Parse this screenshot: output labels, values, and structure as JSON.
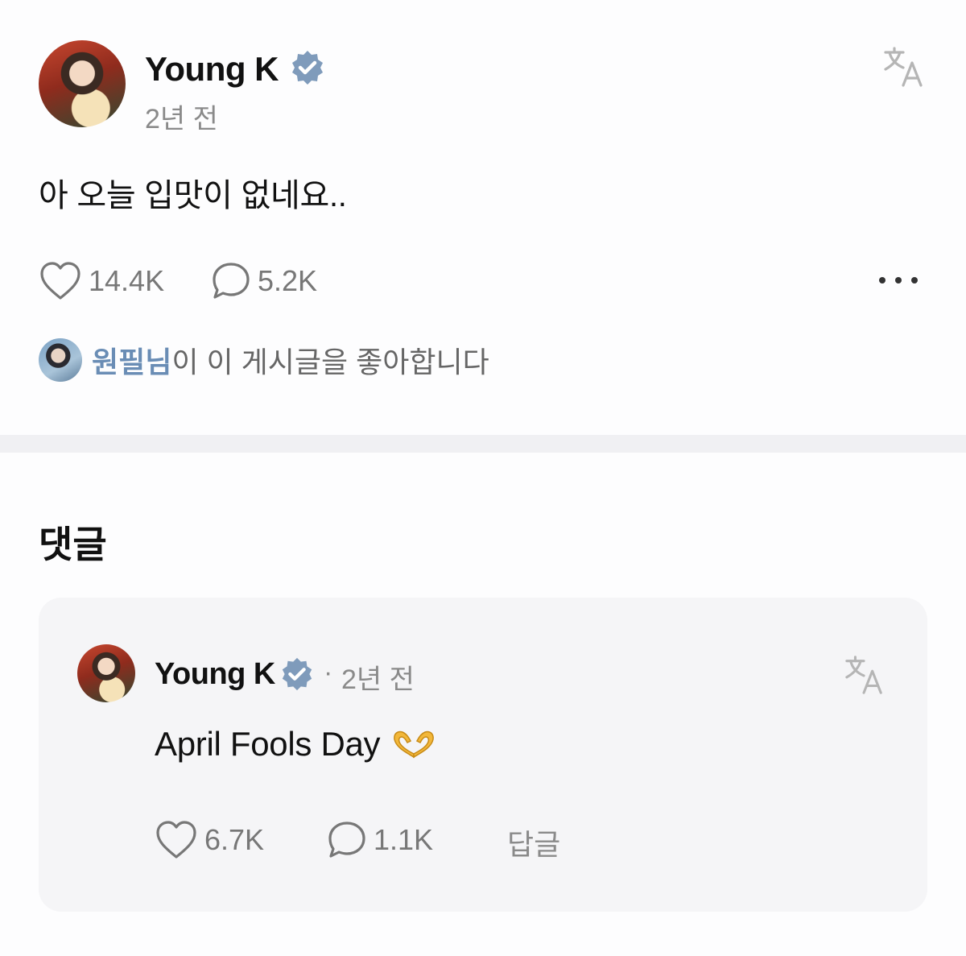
{
  "post": {
    "author": "Young K",
    "time": "2년 전",
    "text": "아 오늘 입맛이 없네요..",
    "likes": "14.4K",
    "comments": "5.2K",
    "liked_by": {
      "name": "원필님",
      "suffix": "이 이 게시글을 좋아합니다"
    }
  },
  "comments_section": {
    "title": "댓글",
    "comment": {
      "author": "Young K",
      "separator": "·",
      "time": "2년 전",
      "text": "April Fools Day",
      "likes": "6.7K",
      "replies": "1.1K",
      "reply_label": "답글"
    }
  },
  "icons": {
    "verified": "verified-badge-icon",
    "translate": "translate-icon",
    "like": "heart-outline-icon",
    "comment": "speech-bubble-icon",
    "more": "more-dots-icon",
    "emoji": "heart-hands-emoji"
  },
  "colors": {
    "verified": "#7f9bbb",
    "muted_text": "#8a8a8a",
    "liked_name": "#6a8db5",
    "card_bg": "#f5f5f7",
    "divider": "#f0f0f3"
  }
}
